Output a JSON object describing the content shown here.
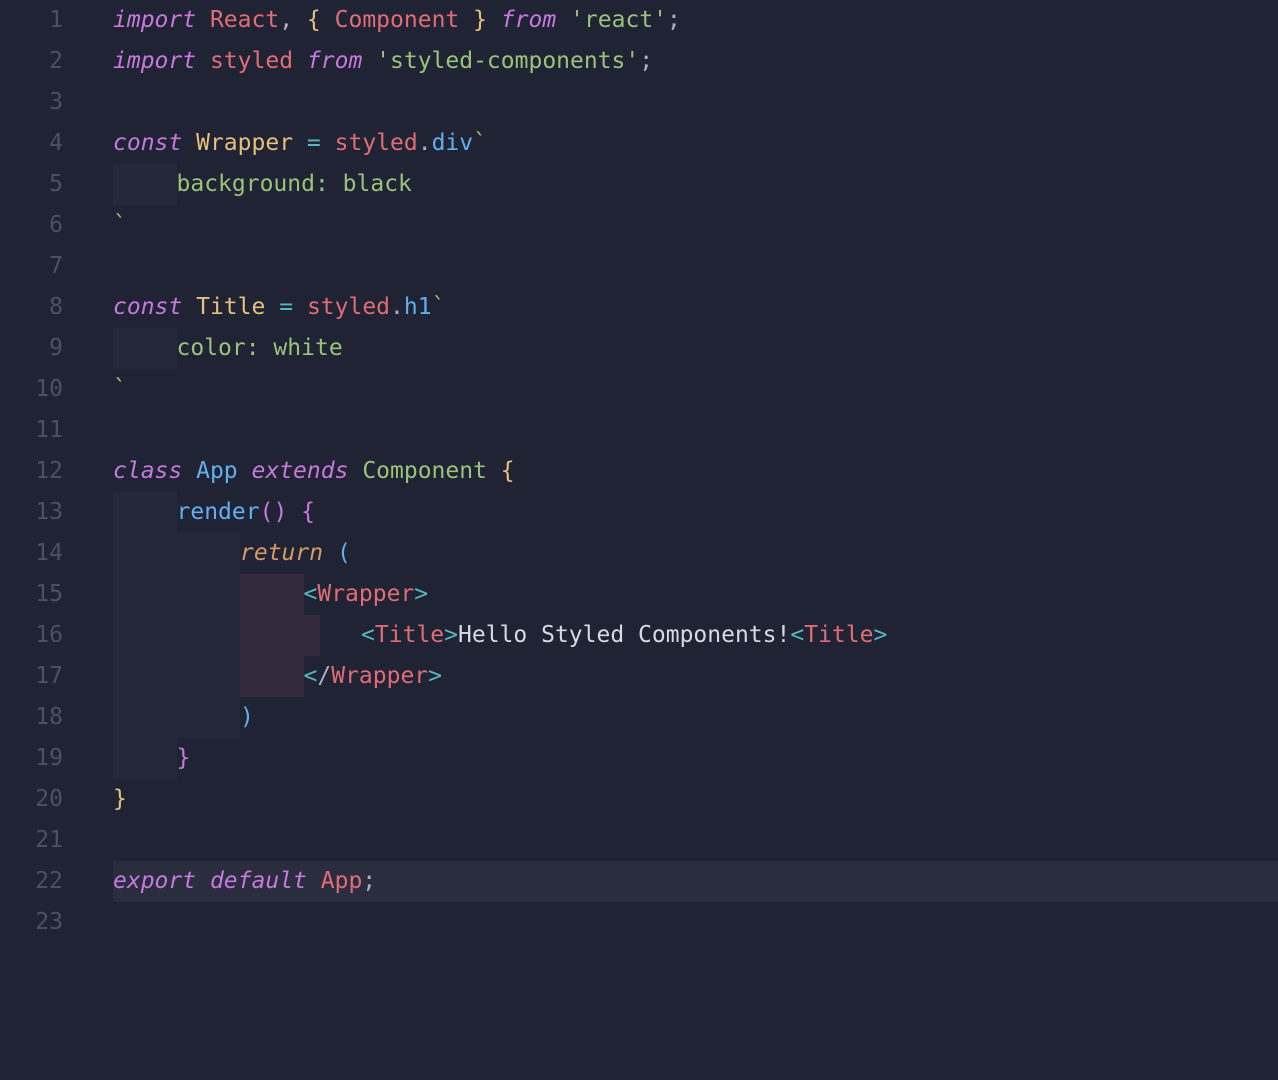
{
  "lineNumbers": [
    "1",
    "2",
    "3",
    "4",
    "5",
    "6",
    "7",
    "8",
    "9",
    "10",
    "11",
    "12",
    "13",
    "14",
    "15",
    "16",
    "17",
    "18",
    "19",
    "20",
    "21",
    "22",
    "23"
  ],
  "highlightLine": 22,
  "tokens": {
    "l1": {
      "import": "import",
      "react": "React",
      "comma": ",",
      "lbrace": "{",
      "component": "Component",
      "rbrace": "}",
      "from": "from",
      "str": "'react'",
      "semi": ";"
    },
    "l2": {
      "import": "import",
      "styled": "styled",
      "from": "from",
      "str": "'styled-components'",
      "semi": ";"
    },
    "l4": {
      "const": "const",
      "wrapper": "Wrapper",
      "eq": "=",
      "styled": "styled",
      "dot": ".",
      "div": "div",
      "tick": "`"
    },
    "l5": {
      "css": "background: black"
    },
    "l6": {
      "tick": "`"
    },
    "l8": {
      "const": "const",
      "title": "Title",
      "eq": "=",
      "styled": "styled",
      "dot": ".",
      "h1": "h1",
      "tick": "`"
    },
    "l9": {
      "css": "color: white"
    },
    "l10": {
      "tick": "`"
    },
    "l12": {
      "class": "class",
      "app": "App",
      "extends": "extends",
      "component": "Component",
      "lbrace": "{"
    },
    "l13": {
      "render": "render",
      "parens": "()",
      "lbrace": "{"
    },
    "l14": {
      "return": "return",
      "lparen": "("
    },
    "l15": {
      "lt": "<",
      "wrapper": "Wrapper",
      "gt": ">"
    },
    "l16": {
      "lt": "<",
      "title": "Title",
      "gt": ">",
      "text": "Hello Styled Components!",
      "lt2": "<",
      "title2": "Title",
      "gt2": ">"
    },
    "l17": {
      "lt": "<",
      "slash": "/",
      "wrapper": "Wrapper",
      "gt": ">"
    },
    "l18": {
      "rparen": ")"
    },
    "l19": {
      "rbrace": "}"
    },
    "l20": {
      "rbrace": "}"
    },
    "l22": {
      "export": "export",
      "default": "default",
      "app": "App",
      "semi": ";"
    }
  }
}
